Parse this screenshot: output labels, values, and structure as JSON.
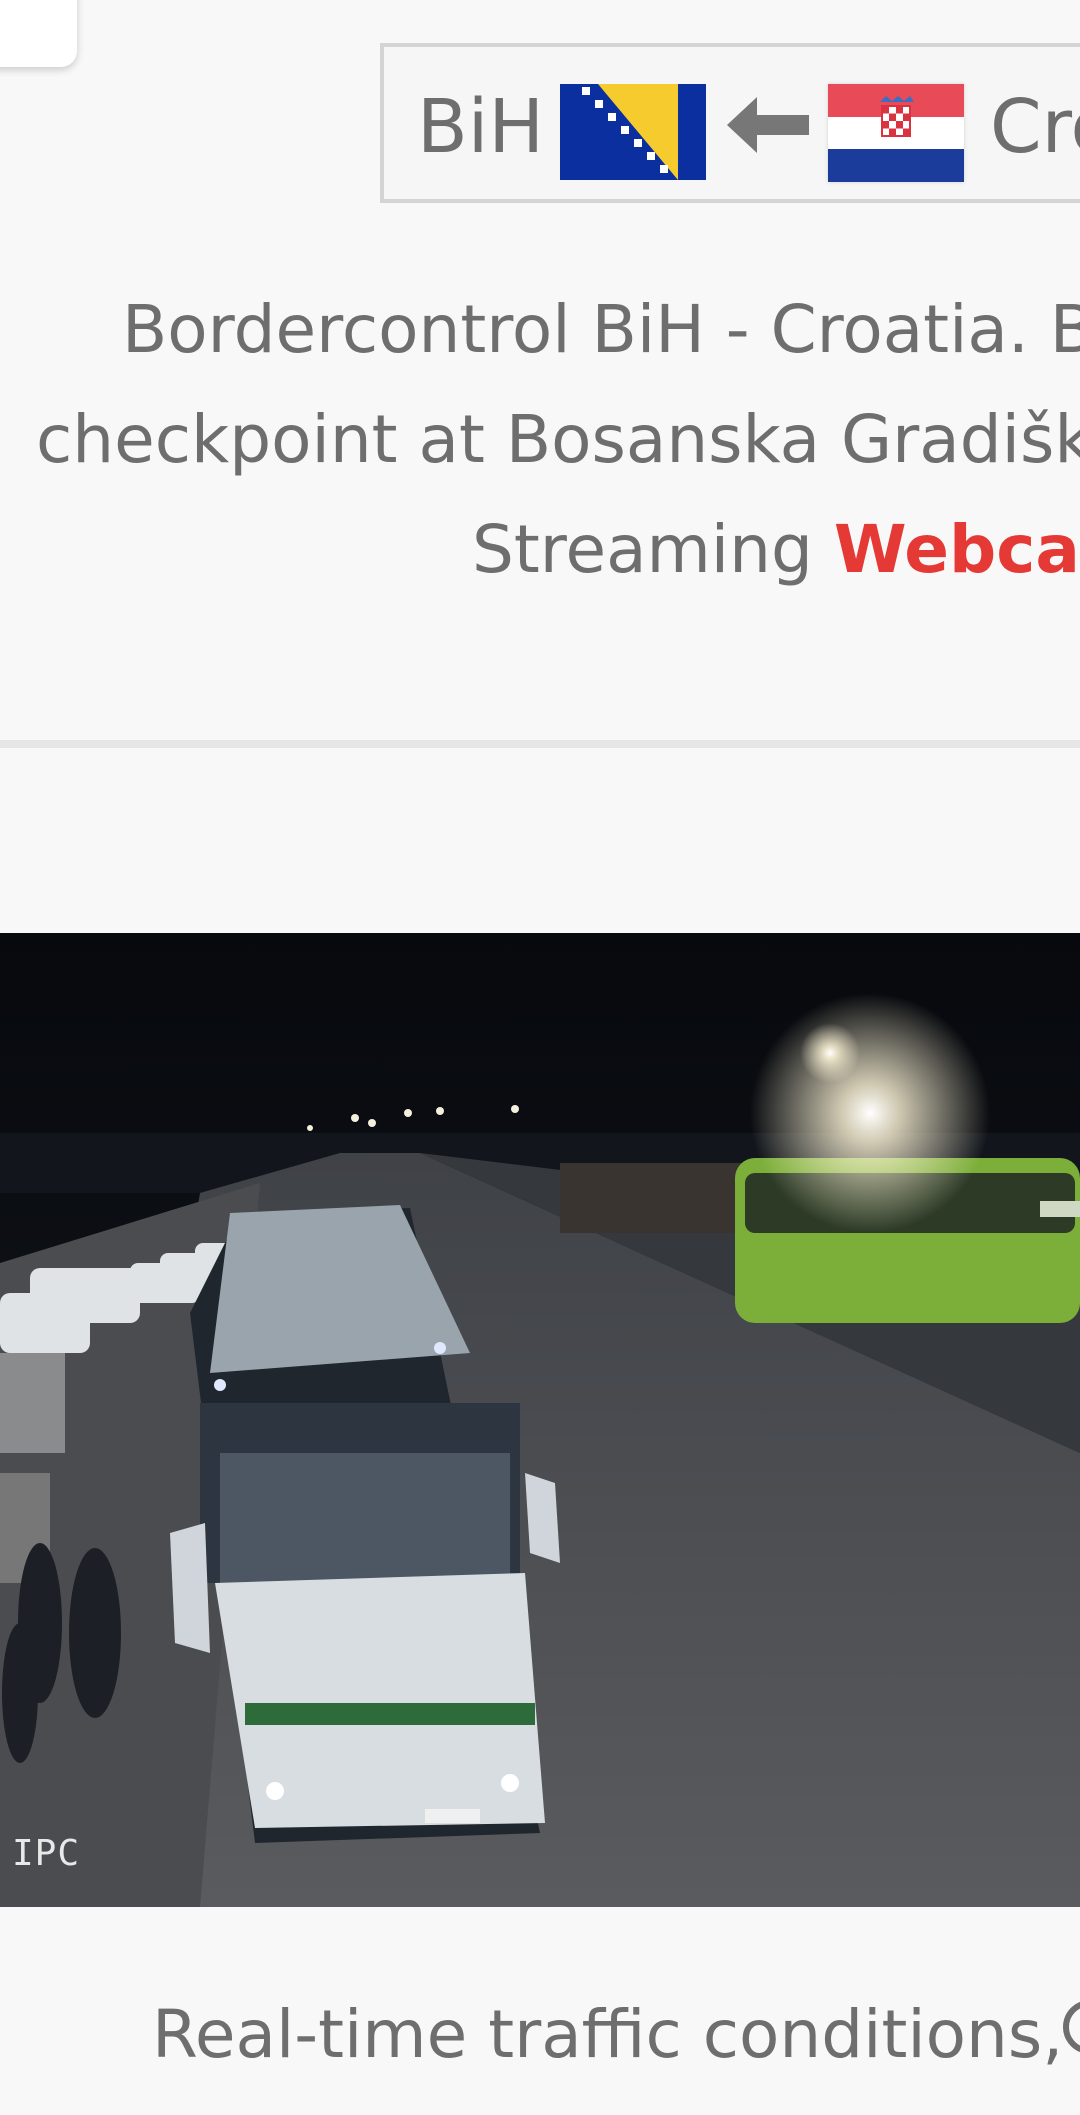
{
  "direction": {
    "from_label": "BiH",
    "to_label": "Cro",
    "from_flag_icon": "bosnia-herzegovina-flag-icon",
    "to_flag_icon": "croatia-flag-icon",
    "arrow_icon": "arrow-left-icon"
  },
  "description": {
    "line1": "Bordercontrol BiH - Croatia. Bo",
    "line2": "checkpoint at Bosanska Gradišk",
    "line3_prefix": "Streaming ",
    "link_label": "Webcam"
  },
  "webcam": {
    "overlay_label": "IPC"
  },
  "footer": {
    "text": "Real-time traffic conditions,"
  },
  "colors": {
    "link": "#e53935",
    "text": "#6e6e6e",
    "background": "#f8f8f8"
  }
}
